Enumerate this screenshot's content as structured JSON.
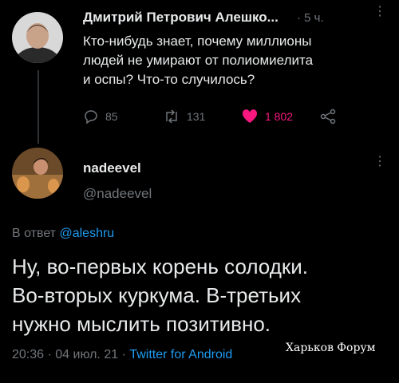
{
  "reply_tweet": {
    "author_name": "Дмитрий Петрович Алешко...",
    "time": "5 ч.",
    "text_lines": [
      "Кто-нибудь знает, почему миллионы",
      "людей не умирают от полиомиелита",
      "и оспы? Что-то случилось?"
    ],
    "actions": {
      "replies": "85",
      "retweets": "131",
      "likes": "1 802"
    },
    "like_color": "#f91880"
  },
  "main_tweet": {
    "display_name": "nadeevel",
    "handle": "@nadeevel",
    "reply_prefix": "В ответ",
    "reply_to": "@aleshru",
    "text_lines": [
      "Ну, во-первых корень солодки.",
      "Во-вторых куркума. В-третьих",
      "нужно мыслить позитивно."
    ],
    "timestamp": "20:36 · 04 июл. 21 ·",
    "source": "Twitter for Android"
  },
  "watermark": "Харьков Форум",
  "icons": {
    "reply": "reply-icon",
    "retweet": "retweet-icon",
    "like": "heart-icon",
    "share": "share-icon",
    "more": "more-options-icon"
  },
  "colors": {
    "background": "#000000",
    "text": "#e7e9ea",
    "muted": "#71767b",
    "link": "#1d9bf0"
  }
}
